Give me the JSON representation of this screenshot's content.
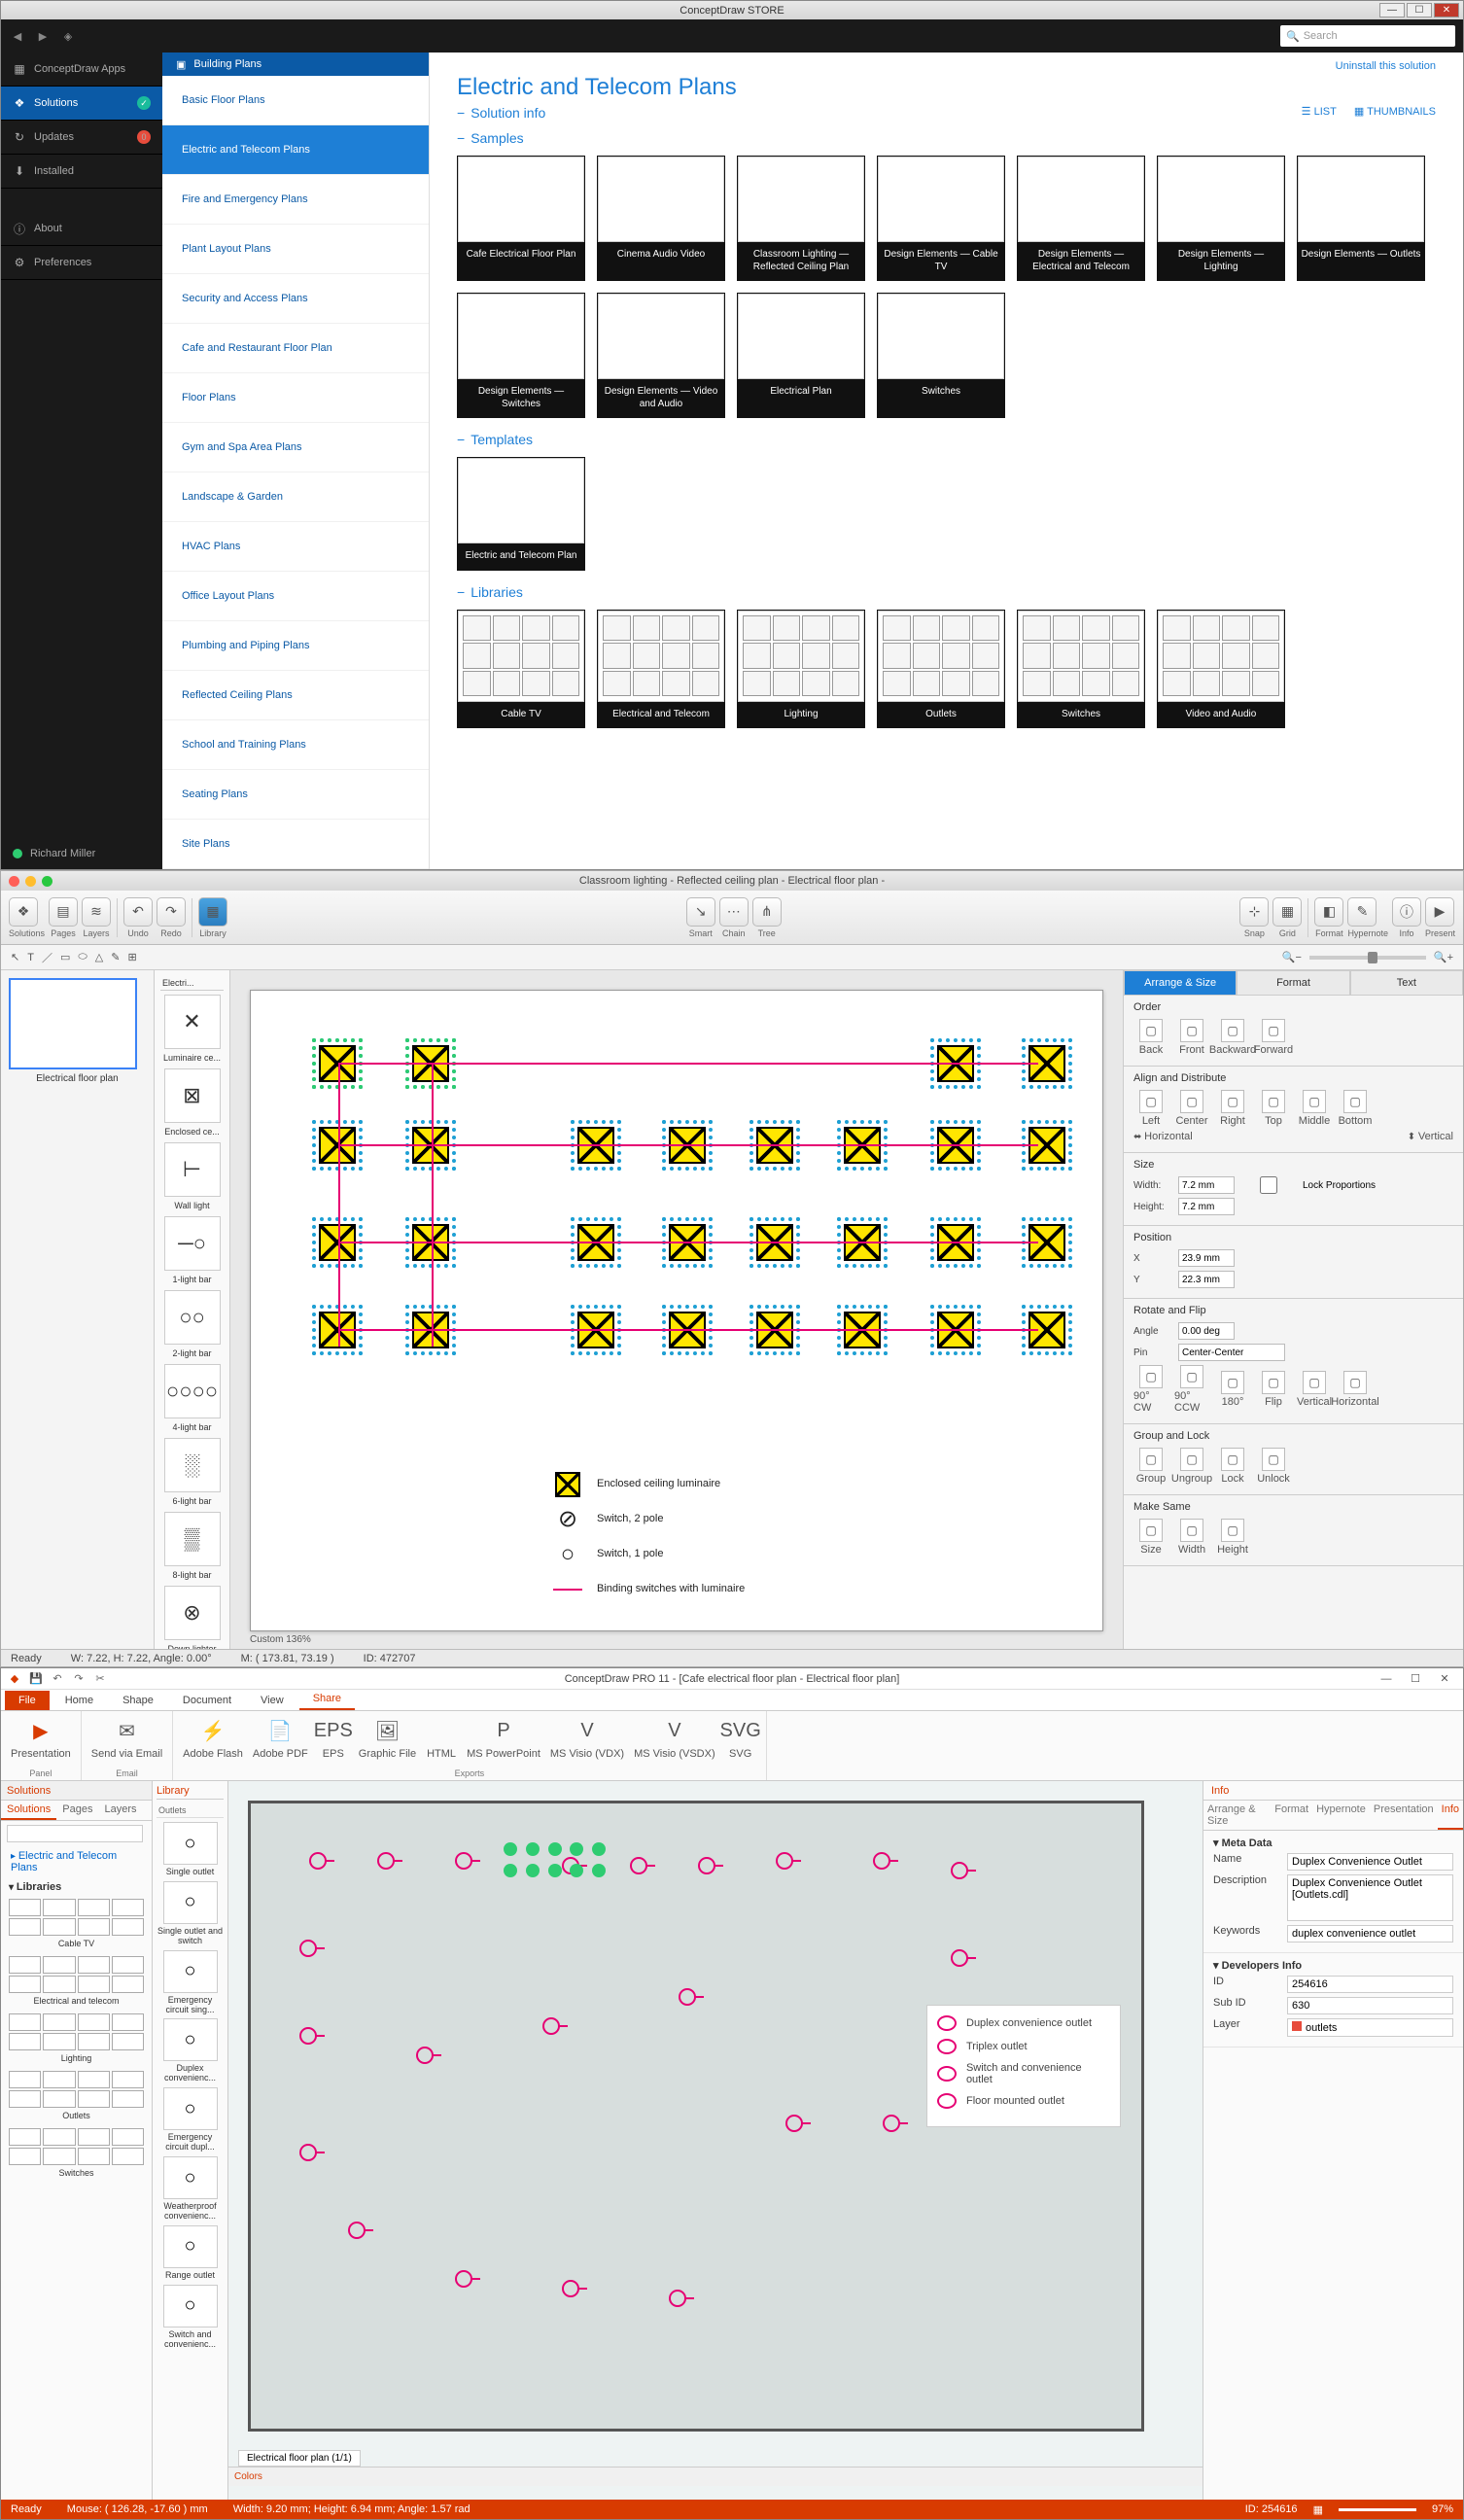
{
  "store": {
    "title": "ConceptDraw STORE",
    "search_ph": "Search",
    "uninstall": "Uninstall this solution",
    "nav": [
      {
        "l": "ConceptDraw Apps",
        "i": "▦"
      },
      {
        "l": "Solutions",
        "i": "❖",
        "sel": true,
        "badge": "✓",
        "bc": "#1abc9c"
      },
      {
        "l": "Updates",
        "i": "↻",
        "badge": "0",
        "bc": "#e74c3c"
      },
      {
        "l": "Installed",
        "i": "⬇"
      },
      {
        "l": "About",
        "i": "ⓘ",
        "sep": true
      },
      {
        "l": "Preferences",
        "i": "⚙"
      }
    ],
    "user": "Richard Miller",
    "cat_hdr": "Building Plans",
    "cats": [
      "Basic Floor Plans",
      "Electric and Telecom Plans",
      "Fire and Emergency Plans",
      "Plant Layout Plans",
      "Security and Access Plans",
      "Cafe and Restaurant Floor Plan",
      "Floor Plans",
      "Gym and Spa Area Plans",
      "Landscape & Garden",
      "HVAC Plans",
      "Office Layout Plans",
      "Plumbing and Piping Plans",
      "Reflected Ceiling Plans",
      "School and Training Plans",
      "Seating Plans",
      "Site Plans"
    ],
    "cat_sel": 1,
    "page_title": "Electric and Telecom Plans",
    "view_list": "LIST",
    "view_thumb": "THUMBNAILS",
    "s_info": "Solution info",
    "s_samples": "Samples",
    "s_templates": "Templates",
    "s_libs": "Libraries",
    "samples": [
      "Cafe Electrical Floor Plan",
      "Cinema Audio Video",
      "Classroom Lighting — Reflected Ceiling Plan",
      "Design Elements — Cable TV",
      "Design Elements — Electrical and Telecom",
      "Design Elements — Lighting",
      "Design Elements — Outlets",
      "Design Elements — Switches",
      "Design Elements — Video and Audio",
      "Electrical Plan",
      "Switches"
    ],
    "templates": [
      "Electric and Telecom Plan"
    ],
    "libs": [
      "Cable TV",
      "Electrical and Telecom",
      "Lighting",
      "Outlets",
      "Switches",
      "Video and Audio"
    ]
  },
  "mac": {
    "title": "Classroom lighting - Reflected ceiling plan - Electrical floor plan -",
    "page_label": "Electrical floor plan",
    "tb": {
      "solutions": "Solutions",
      "pages": "Pages",
      "layers": "Layers",
      "undo": "Undo",
      "redo": "Redo",
      "library": "Library",
      "smart": "Smart",
      "chain": "Chain",
      "tree": "Tree",
      "snap": "Snap",
      "grid": "Grid",
      "format": "Format",
      "hyperlink": "Hypernote",
      "info": "Info",
      "present": "Present"
    },
    "shapes_title": "Electri...",
    "shapes": [
      {
        "l": "Luminaire ce...",
        "g": "✕"
      },
      {
        "l": "Enclosed ce...",
        "g": "⊠"
      },
      {
        "l": "Wall light",
        "g": "⊢"
      },
      {
        "l": "1-light bar",
        "g": "─○"
      },
      {
        "l": "2-light bar",
        "g": "○○"
      },
      {
        "l": "4-light bar",
        "g": "○○○○"
      },
      {
        "l": "6-light bar",
        "g": "░"
      },
      {
        "l": "8-light bar",
        "g": "▒"
      },
      {
        "l": "Down lighter",
        "g": "⊗"
      }
    ],
    "legend": [
      {
        "t": "Enclosed ceiling luminaire"
      },
      {
        "t": "Switch, 2 pole"
      },
      {
        "t": "Switch, 1 pole"
      },
      {
        "t": "Binding switches with luminaire"
      }
    ],
    "zoom": "Custom 136%",
    "sb": {
      "ready": "Ready",
      "wh": "W: 7.22, H: 7.22, Angle: 0.00°",
      "m": "M: ( 173.81, 73.19 )",
      "id": "ID: 472707"
    },
    "rp": {
      "tabs": [
        "Arrange & Size",
        "Format",
        "Text"
      ],
      "order": "Order",
      "ord": [
        "Back",
        "Front",
        "Backward",
        "Forward"
      ],
      "align": "Align and Distribute",
      "al": [
        "Left",
        "Center",
        "Right",
        "Top",
        "Middle",
        "Bottom"
      ],
      "alH": "Horizontal",
      "alV": "Vertical",
      "size": "Size",
      "w": "Width:",
      "h": "Height:",
      "wv": "7.2 mm",
      "hv": "7.2 mm",
      "lock": "Lock Proportions",
      "pos": "Position",
      "x": "X",
      "y": "Y",
      "xv": "23.9 mm",
      "yv": "22.3 mm",
      "rot": "Rotate and Flip",
      "ang": "Angle",
      "av": "0.00 deg",
      "pin": "Pin",
      "pv": "Center-Center",
      "rl": [
        "90° CW",
        "90° CCW",
        "180°",
        "Flip",
        "Vertical",
        "Horizontal"
      ],
      "grp": "Group and Lock",
      "gl": [
        "Group",
        "Ungroup",
        "Lock",
        "Unlock"
      ],
      "ms": "Make Same",
      "msl": [
        "Size",
        "Width",
        "Height"
      ]
    }
  },
  "win": {
    "title": "ConceptDraw PRO 11 - [Cafe electrical floor plan - Electrical floor plan]",
    "tabs": [
      "File",
      "Home",
      "Shape",
      "Document",
      "View",
      "Share"
    ],
    "tab_on": 5,
    "rib": {
      "panel": "Panel",
      "presentation": "Presentation",
      "email": "Email",
      "send": "Send via Email",
      "exports": "Exports",
      "ex": [
        "Adobe Flash",
        "Adobe PDF",
        "EPS",
        "Graphic File",
        "HTML",
        "MS PowerPoint",
        "MS Visio (VDX)",
        "MS Visio (VSDX)",
        "SVG"
      ]
    },
    "sol": {
      "hd": "Solutions",
      "tabs": [
        "Solutions",
        "Pages",
        "Layers"
      ],
      "search_ph": "",
      "link": "Electric and Telecom Plans",
      "libs": "Libraries",
      "items": [
        "Cable TV",
        "Electrical and telecom",
        "Lighting",
        "Outlets",
        "Switches"
      ]
    },
    "lib": {
      "hd": "Library",
      "tab": "Outlets",
      "items": [
        "Single outlet",
        "Single outlet and switch",
        "Emergency circuit sing...",
        "Duplex convenienc...",
        "Emergency circuit dupl...",
        "Weatherproof convenienc...",
        "Range outlet",
        "Switch and convenienc..."
      ]
    },
    "legend": [
      "Duplex convenience outlet",
      "Triplex outlet",
      "Switch and convenience outlet",
      "Floor mounted outlet"
    ],
    "page_tab": "Electrical floor plan (1/1)",
    "colors": "Colors",
    "info": {
      "hd": "Info",
      "tabs": [
        "Arrange & Size",
        "Format",
        "Hypernote",
        "Presentation",
        "Info"
      ],
      "tab_on": 4,
      "meta": "Meta Data",
      "name_l": "Name",
      "name_v": "Duplex Convenience Outlet",
      "desc_l": "Description",
      "desc_v": "Duplex Convenience Outlet [Outlets.cdl]",
      "kw_l": "Keywords",
      "kw_v": "duplex convenience outlet",
      "dev": "Developers Info",
      "id_l": "ID",
      "id_v": "254616",
      "sub_l": "Sub ID",
      "sub_v": "630",
      "lay_l": "Layer",
      "lay_v": "outlets"
    },
    "sb": {
      "ready": "Ready",
      "mouse": "Mouse: ( 126.28, -17.60 ) mm",
      "obj": "Width: 9.20 mm;  Height: 6.94 mm;  Angle: 1.57 rad",
      "id": "ID: 254616",
      "zoom": "97%"
    }
  }
}
